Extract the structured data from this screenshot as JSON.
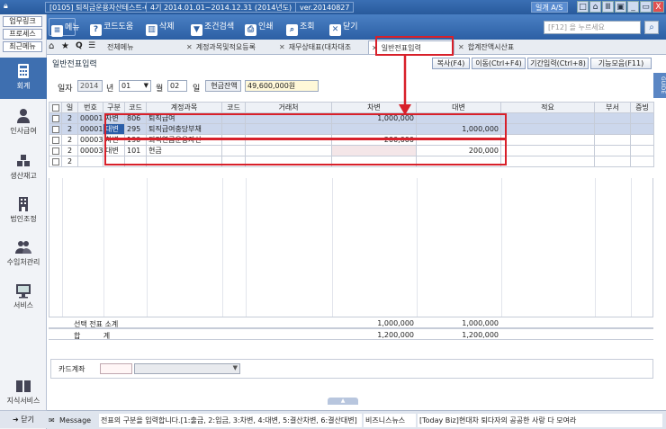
{
  "titlebar": {
    "company": "[0105] 퇴직금운용자산테스트-0826",
    "period": "4기 2014.01.01~2014.12.31 (2014년도)",
    "version": "ver.20140827",
    "user_btn": "일개 A/S",
    "controls": [
      "□",
      "⌂",
      "Ⅲ",
      "▣",
      "_",
      "▭",
      "X"
    ]
  },
  "sidebar": {
    "top_buttons": [
      "업무링크",
      "프로세스",
      "최근메뉴"
    ],
    "menus": [
      {
        "label": "회계",
        "icon": "calculator-icon"
      },
      {
        "label": "인사급여",
        "icon": "person-icon"
      },
      {
        "label": "생산재고",
        "icon": "boxes-icon"
      },
      {
        "label": "법인조정",
        "icon": "building-icon"
      },
      {
        "label": "수임처관리",
        "icon": "people-icon"
      },
      {
        "label": "서비스",
        "icon": "monitor-icon"
      }
    ],
    "knowledge": "지식서비스",
    "close": "닫기"
  },
  "toolbar": {
    "menu": "메뉴",
    "help": "코드도움",
    "delete": "삭제",
    "condition": "조건검색",
    "print": "인쇄",
    "view": "조회",
    "close": "닫기",
    "search_placeholder": "[F12] 을 누르세요"
  },
  "tabs": {
    "home": "전체메뉴",
    "items": [
      "계정과목및적요등록",
      "재무상태표(대차대조",
      "일반전표입력",
      "합계잔액시산표"
    ],
    "active": "일반전표입력"
  },
  "page": {
    "title": "일반전표입력",
    "actions": [
      "복사(F4)",
      "이동(Ctrl+F4)",
      "기간입력(Ctrl+8)",
      "기능모음(F11)"
    ],
    "guide": "GUIDE",
    "date_label": "일자",
    "year": "2014",
    "year_suffix": "년",
    "month": "01",
    "month_suffix": "월",
    "day": "02",
    "day_suffix": "일",
    "cash_label": "현금잔액",
    "cash_value": "49,600,000원"
  },
  "grid": {
    "headers": [
      "일",
      "번호",
      "구분",
      "코드",
      "계정과목",
      "코드",
      "거래처",
      "차변",
      "대변",
      "적요",
      "부서",
      "증빙"
    ],
    "rows": [
      {
        "day": "2",
        "no": "00001",
        "type": "차변",
        "code": "806",
        "account": "퇴직급여",
        "pcode": "",
        "partner": "",
        "debit": "1,000,000",
        "credit": "",
        "memo": ""
      },
      {
        "day": "2",
        "no": "00001",
        "type": "대변",
        "code": "295",
        "account": "퇴직급여충당부채",
        "pcode": "",
        "partner": "",
        "debit": "",
        "credit": "1,000,000",
        "memo": ""
      },
      {
        "day": "2",
        "no": "00003",
        "type": "차변",
        "code": "190",
        "account": "퇴직연금운용자산",
        "pcode": "",
        "partner": "",
        "debit": "200,000",
        "credit": "",
        "memo": ""
      },
      {
        "day": "2",
        "no": "00003",
        "type": "대변",
        "code": "101",
        "account": "현금",
        "pcode": "",
        "partner": "",
        "debit": "",
        "credit": "200,000",
        "memo": ""
      },
      {
        "day": "2",
        "no": "",
        "type": "",
        "code": "",
        "account": "",
        "pcode": "",
        "partner": "",
        "debit": "",
        "credit": "",
        "memo": ""
      }
    ]
  },
  "totals": {
    "selected_label": "선택 전표 소계",
    "selected_debit": "1,000,000",
    "selected_credit": "1,000,000",
    "sum_label": "합          계",
    "sum_debit": "1,200,000",
    "sum_credit": "1,200,000"
  },
  "card": {
    "label": "카드계좌"
  },
  "bottom": {
    "message_tab": "Message",
    "message": "전표의 구분을 입력합니다.[1:출금, 2:입금, 3:차변, 4:대변, 5:결산차변, 6:결산대변]",
    "biz": "비즈니스뉴스",
    "news": "[Today Biz]현대차 퇴다자의 공공한 사랑 다 모여라"
  },
  "colors": {
    "toolbar": "#2c5fa4",
    "highlight": "#d8202a",
    "selected_row": "#ccd7ec"
  }
}
